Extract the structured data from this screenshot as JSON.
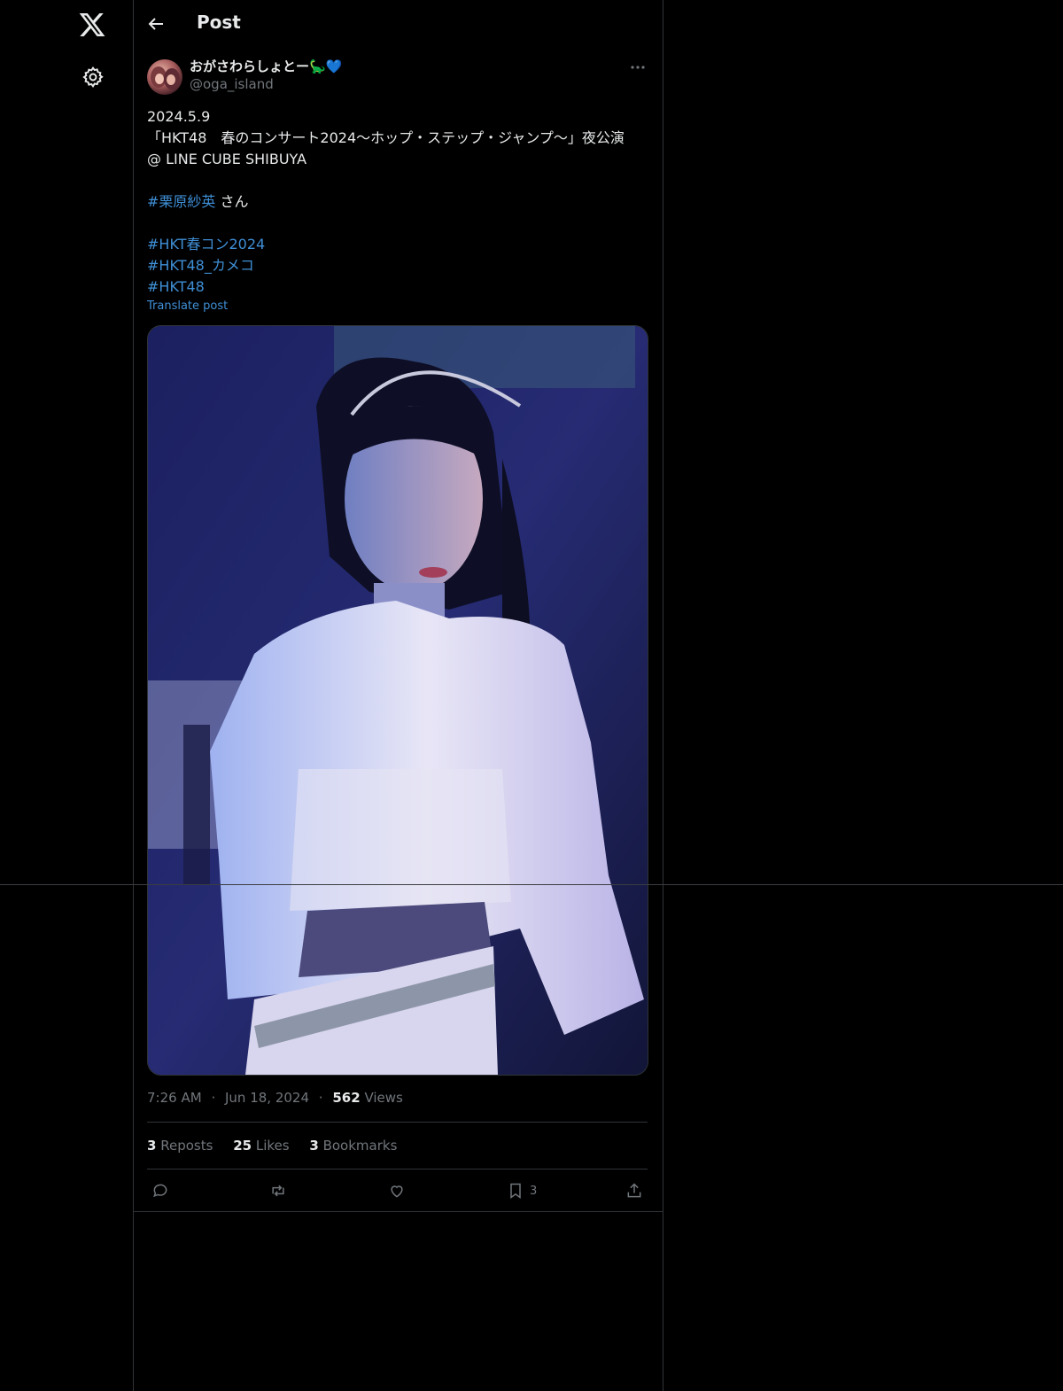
{
  "header": {
    "title": "Post"
  },
  "post": {
    "display_name": "おがさわらしょとー🦕💙",
    "handle": "@oga_island",
    "text_lines": [
      "2024.5.9",
      "「HKT48　春のコンサート2024〜ホップ・ステップ・ジャンプ〜」夜公演",
      "@ LINE CUBE SHIBUYA"
    ],
    "mention_tag": "#栗原紗英",
    "mention_suffix": " さん",
    "hashtags": [
      "#HKT春コン2024",
      "#HKT48_カメコ",
      "#HKT48"
    ],
    "translate_label": "Translate post",
    "time": "7:26 AM",
    "date": "Jun 18, 2024",
    "views_count": "562",
    "views_label": "Views",
    "separator": "·"
  },
  "stats": {
    "reposts_count": "3",
    "reposts_label": "Reposts",
    "likes_count": "25",
    "likes_label": "Likes",
    "bookmarks_count": "3",
    "bookmarks_label": "Bookmarks"
  },
  "actions": {
    "bookmark_count": "3"
  },
  "icons": [
    "x-logo-icon",
    "settings-icon",
    "back-arrow-icon",
    "more-icon",
    "reply-icon",
    "repost-icon",
    "like-icon",
    "bookmark-icon",
    "share-icon"
  ],
  "colors": {
    "background": "#000000",
    "text": "#e7e9ea",
    "muted": "#71767b",
    "link": "#3f8fd6",
    "border": "#2f3336"
  }
}
